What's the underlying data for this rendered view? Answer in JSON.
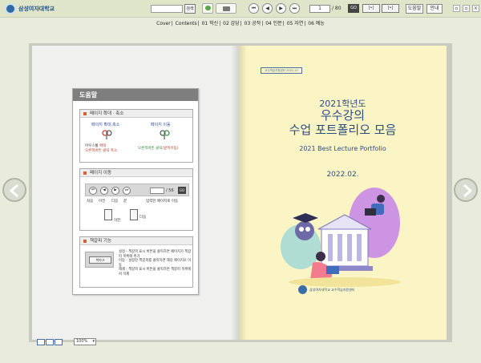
{
  "logo": {
    "name": "삼성여자대학교"
  },
  "toolbar": {
    "search_label": "검색",
    "current_page": "1",
    "total_pages": "/ 80",
    "go_label": "GO",
    "view_button_1": "[•]",
    "view_button_2": "[•]",
    "help_label": "도움말",
    "guide_label": "안내",
    "nav_first": "⏮",
    "nav_prev": "◀",
    "nav_next": "▶",
    "nav_last": "⏭"
  },
  "toc": {
    "items": [
      "Cover",
      "Contents",
      "01 학신",
      "02 감당",
      "03 공작",
      "04 인문",
      "05 자연",
      "06 예능"
    ]
  },
  "help": {
    "title": "도움말",
    "section1": {
      "title": "페이지 확대 · 축소",
      "left_title": "페이지 확대,축소",
      "left_text_1": "마우스휠",
      "left_text_red_1": "확대",
      "left_text_2": "오른쪽버튼 클릭 축소",
      "right_title": "페이지 이동",
      "right_text_1": "오른쪽버튼 클릭",
      "right_text_red": "(앞뒤이동)"
    },
    "section2": {
      "title": "페이지 이동",
      "total": "/ 56",
      "go": "GO",
      "labels": [
        "처음",
        "이전",
        "다음",
        "끝",
        "입력한 페이지로 이동"
      ],
      "prev_label": "이전",
      "next_label": "다음"
    },
    "section3": {
      "title": "책갈피 기능",
      "button": "북마크",
      "line1": "설정 - 책갈피 표시 버튼을 클릭하면 페이지가 책갈피 목록에 추가",
      "line2": "이동 - 설정된 책갈피를 클릭하면 해당 페이지로 이동",
      "line3": "해제 - 책갈피 표시 버튼을 클릭하면 책갈피 목록에서 삭제"
    }
  },
  "cover": {
    "tag": "교수학습지원센터 2021-13",
    "year": "2021학년도",
    "title_line1": "우수강의",
    "title_line2": "수업 포트폴리오 모음",
    "subtitle": "2021 Best Lecture Portfolio",
    "date": "2022.02.",
    "org": "삼성여자대학교 교수학습지원센터"
  },
  "bottom": {
    "zoom": "100%"
  },
  "colors": {
    "accent": "#2c4c87",
    "cover_bg": "#fbf5c5",
    "toolbar_bg": "#dfe5c9"
  }
}
